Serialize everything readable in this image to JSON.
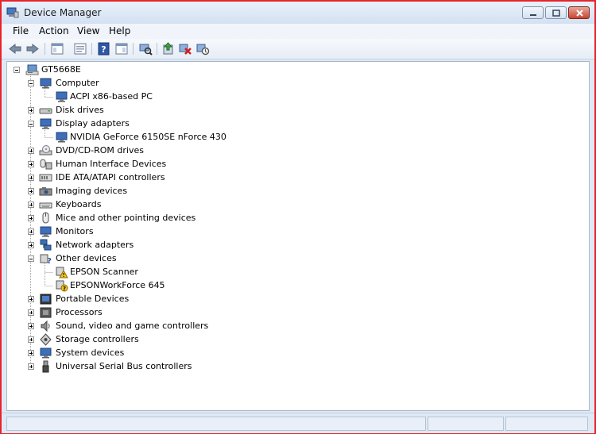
{
  "window": {
    "title": "Device Manager"
  },
  "menubar": {
    "items": [
      "File",
      "Action",
      "View",
      "Help"
    ]
  },
  "toolbar": {
    "buttons": [
      "back-icon",
      "forward-icon",
      "show-hide-console-tree-icon",
      "properties-icon",
      "help-icon",
      "show-hide-action-pane-icon",
      "scan-hardware-icon",
      "update-driver-icon",
      "uninstall-icon",
      "disable-icon"
    ]
  },
  "tree": {
    "root": "GT5668E",
    "items": [
      {
        "label": "Computer",
        "expanded": true,
        "icon": "computer-icon",
        "children": [
          "ACPI x86-based PC"
        ]
      },
      {
        "label": "Disk drives",
        "expanded": false,
        "icon": "disk-drive-icon"
      },
      {
        "label": "Display adapters",
        "expanded": true,
        "icon": "display-adapter-icon",
        "children": [
          "NVIDIA GeForce 6150SE nForce 430"
        ]
      },
      {
        "label": "DVD/CD-ROM drives",
        "expanded": false,
        "icon": "dvd-drive-icon"
      },
      {
        "label": "Human Interface Devices",
        "expanded": false,
        "icon": "hid-icon"
      },
      {
        "label": "IDE ATA/ATAPI controllers",
        "expanded": false,
        "icon": "ide-controller-icon"
      },
      {
        "label": "Imaging devices",
        "expanded": false,
        "icon": "camera-icon"
      },
      {
        "label": "Keyboards",
        "expanded": false,
        "icon": "keyboard-icon"
      },
      {
        "label": "Mice and other pointing devices",
        "expanded": false,
        "icon": "mouse-icon"
      },
      {
        "label": "Monitors",
        "expanded": false,
        "icon": "monitor-icon"
      },
      {
        "label": "Network adapters",
        "expanded": false,
        "icon": "network-icon"
      },
      {
        "label": "Other devices",
        "expanded": true,
        "icon": "unknown-device-icon",
        "children": [
          "EPSON Scanner",
          "EPSONWorkForce 645"
        ]
      },
      {
        "label": "Portable Devices",
        "expanded": false,
        "icon": "portable-device-icon"
      },
      {
        "label": "Processors",
        "expanded": false,
        "icon": "processor-icon"
      },
      {
        "label": "Sound, video and game controllers",
        "expanded": false,
        "icon": "speaker-icon"
      },
      {
        "label": "Storage controllers",
        "expanded": false,
        "icon": "storage-controller-icon"
      },
      {
        "label": "System devices",
        "expanded": false,
        "icon": "system-device-icon"
      },
      {
        "label": "Universal Serial Bus controllers",
        "expanded": false,
        "icon": "usb-icon"
      }
    ]
  },
  "colors": {
    "frame_highlight": "#e8232a",
    "chrome": "#dfe9f5",
    "tree_bg": "#ffffff"
  }
}
